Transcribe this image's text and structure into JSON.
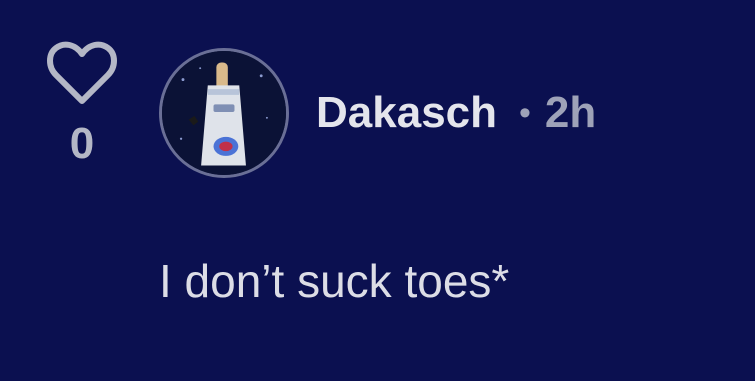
{
  "comment": {
    "like_count": "0",
    "username": "Dakasch",
    "separator": "•",
    "timestamp": "2h",
    "text": "I don’t suck toes*"
  },
  "icons": {
    "like": "heart-outline-icon",
    "avatar": "avatar-image"
  },
  "colors": {
    "background": "#0b1050",
    "username": "#e4e5ec",
    "muted": "#9ea2b8",
    "text": "#dcdde6",
    "avatar_border": "#6a6f96"
  }
}
